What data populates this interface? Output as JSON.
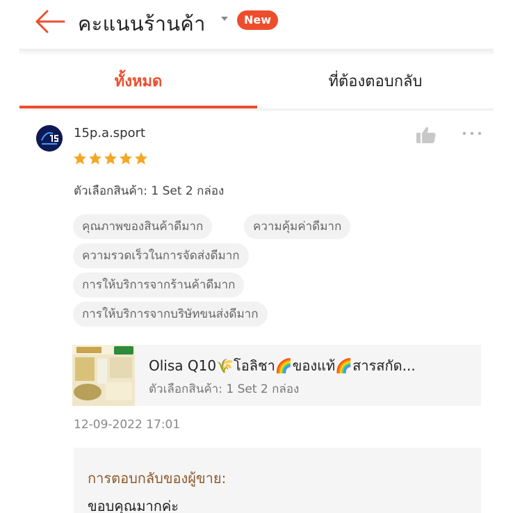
{
  "header": {
    "title": "คะแนนร้านค้า",
    "badge": "New",
    "accent_color": "#ee4d2d",
    "icons": [
      "arrow-left-icon",
      "caret-down-icon"
    ]
  },
  "tabs": [
    {
      "label": "ทั้งหมด",
      "active": true
    },
    {
      "label": "ที่ต้องตอบกลับ",
      "active": false
    }
  ],
  "review": {
    "username": "15p.a.sport",
    "rating": 5,
    "max_rating": 5,
    "variation": "ตัวเลือกสินค้า: 1 Set 2 กล่อง",
    "tags": [
      "คุณภาพของสินค้าดีมาก",
      "ความคุ้มค่าดีมาก",
      "ความรวดเร็วในการจัดส่งดีมาก",
      "การให้บริการจากร้านค้าดีมาก",
      "การให้บริการจากบริษัทขนส่งดีมาก"
    ],
    "product": {
      "name": "Olisa Q10🌾โอลิชา🌈ของแท้🌈สารสกัด...",
      "variation": "ตัวเลือกสินค้า: 1 Set 2 กล่อง"
    },
    "datetime": "12-09-2022 17:01",
    "seller_reply": {
      "label": "การตอบกลับของผู้ขาย:",
      "text": "ขอบคุณมากค่ะ"
    },
    "icons": [
      "avatar-logo",
      "thumbs-up-icon",
      "more-options-icon",
      "star-icon"
    ]
  }
}
